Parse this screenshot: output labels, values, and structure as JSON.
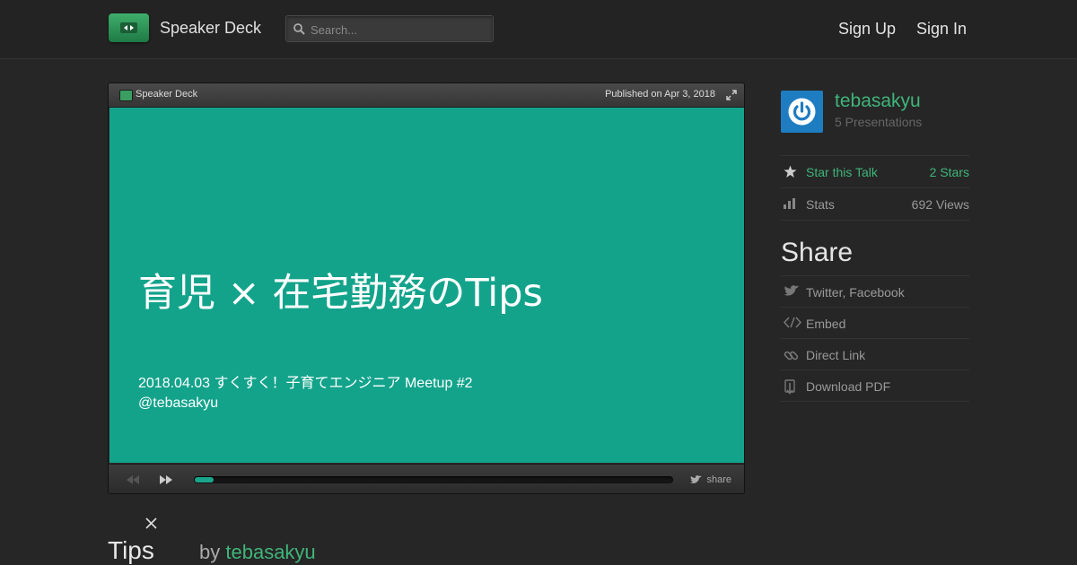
{
  "header": {
    "brand": "Speaker Deck",
    "search_placeholder": "Search...",
    "sign_up": "Sign Up",
    "sign_in": "Sign In"
  },
  "player": {
    "brand": "Speaker Deck",
    "published": "Published on Apr 3, 2018",
    "slide_title": "育児 × 在宅勤務のTips",
    "slide_subtitle_line1": "2018.04.03 すくすく！子育てエンジニア Meetup #2",
    "slide_subtitle_line2": "@tebasakyu",
    "share_label": "share",
    "progress": 0.04
  },
  "talk": {
    "title": "Tips",
    "by": "by",
    "author": "tebasakyu"
  },
  "sidebar": {
    "user_name": "tebasakyu",
    "presentations": "5 Presentations",
    "star_label": "Star this Talk",
    "star_count": "2 Stars",
    "stats_label": "Stats",
    "stats_views": "692 Views",
    "share_heading": "Share",
    "share_items": [
      "Twitter, Facebook",
      "Embed",
      "Direct Link",
      "Download PDF"
    ]
  },
  "colors": {
    "accent_green": "#3fb57a",
    "slide_teal": "#13a38b",
    "avatar_blue": "#1e7cc0"
  }
}
